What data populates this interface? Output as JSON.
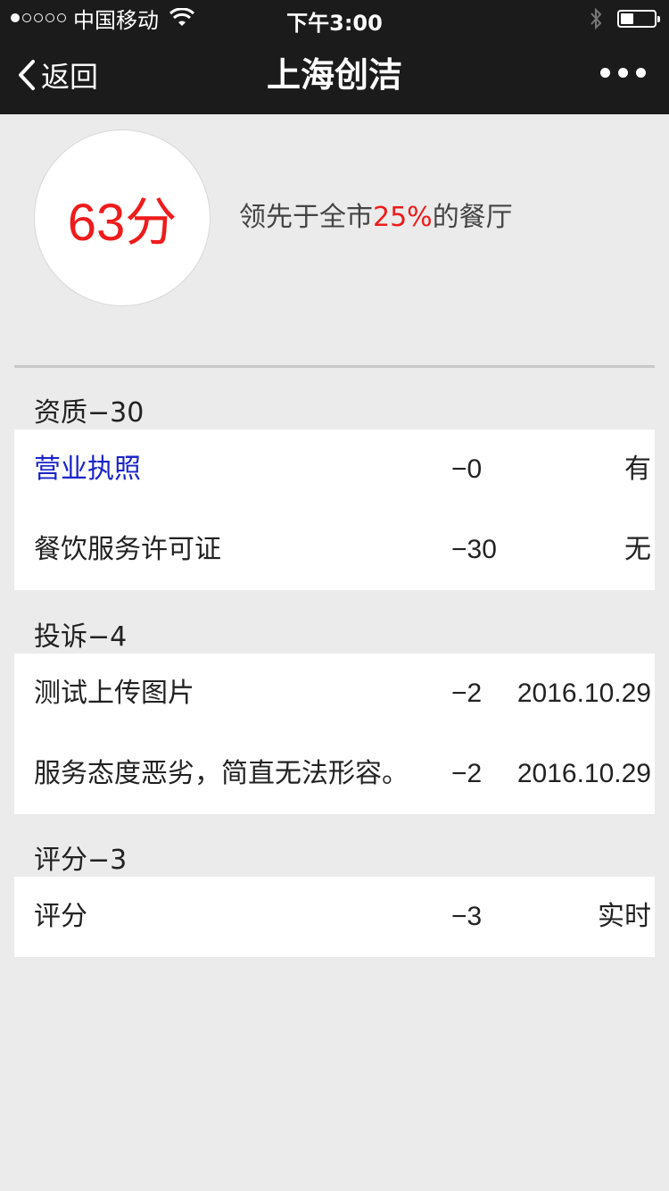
{
  "status_bar": {
    "carrier": "中国移动",
    "time": "下午3:00",
    "battery_level": 0.4
  },
  "nav": {
    "back_label": "返回",
    "title": "上海创洁"
  },
  "score": {
    "value": "63分",
    "rank_prefix": "领先于全市",
    "rank_percent": "25%",
    "rank_suffix": "的餐厅"
  },
  "sections": [
    {
      "header": "资质−30",
      "rows": [
        {
          "name": "营业执照",
          "deduct": "−0",
          "status": "有",
          "link": true
        },
        {
          "name": "餐饮服务许可证",
          "deduct": "−30",
          "status": "无",
          "link": false
        }
      ]
    },
    {
      "header": "投诉−4",
      "rows": [
        {
          "name": "测试上传图片",
          "deduct": "−2",
          "status": "2016.10.29",
          "link": false
        },
        {
          "name": "服务态度恶劣，简直无法形容。",
          "deduct": "−2",
          "status": "2016.10.29",
          "link": false
        }
      ]
    },
    {
      "header": "评分−3",
      "rows": [
        {
          "name": "评分",
          "deduct": "−3",
          "status": "实时",
          "link": false
        }
      ]
    }
  ],
  "colors": {
    "accent_red": "#ee1c1c",
    "link_blue": "#1a24c8",
    "nav_bg": "#1b1b1b"
  }
}
